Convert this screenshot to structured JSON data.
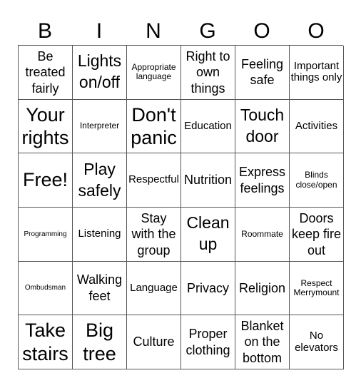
{
  "header": [
    "B",
    "I",
    "N",
    "G",
    "O",
    "O"
  ],
  "cells": [
    {
      "text": "Be treated fairly",
      "size": "l"
    },
    {
      "text": "Lights on/off",
      "size": "xl"
    },
    {
      "text": "Appropriate language",
      "size": "s"
    },
    {
      "text": "Right to own things",
      "size": "l"
    },
    {
      "text": "Feeling safe",
      "size": "l"
    },
    {
      "text": "Important things only",
      "size": "m"
    },
    {
      "text": "Your rights",
      "size": "xxl"
    },
    {
      "text": "Interpreter",
      "size": "s"
    },
    {
      "text": "Don't panic",
      "size": "xxl"
    },
    {
      "text": "Education",
      "size": "m"
    },
    {
      "text": "Touch door",
      "size": "xl"
    },
    {
      "text": "Activities",
      "size": "m"
    },
    {
      "text": "Free!",
      "size": "xxl"
    },
    {
      "text": "Play safely",
      "size": "xl"
    },
    {
      "text": "Respectful",
      "size": "m"
    },
    {
      "text": "Nutrition",
      "size": "l"
    },
    {
      "text": "Express feelings",
      "size": "l"
    },
    {
      "text": "Blinds close/open",
      "size": "s"
    },
    {
      "text": "Programming",
      "size": "xs"
    },
    {
      "text": "Listening",
      "size": "m"
    },
    {
      "text": "Stay with the group",
      "size": "l"
    },
    {
      "text": "Clean up",
      "size": "xl"
    },
    {
      "text": "Roommate",
      "size": "s"
    },
    {
      "text": "Doors keep fire out",
      "size": "l"
    },
    {
      "text": "Ombudsman",
      "size": "xs"
    },
    {
      "text": "Walking feet",
      "size": "l"
    },
    {
      "text": "Language",
      "size": "m"
    },
    {
      "text": "Privacy",
      "size": "l"
    },
    {
      "text": "Religion",
      "size": "l"
    },
    {
      "text": "Respect Merrymount",
      "size": "s"
    },
    {
      "text": "Take stairs",
      "size": "xxl"
    },
    {
      "text": "Big tree",
      "size": "xxl"
    },
    {
      "text": "Culture",
      "size": "l"
    },
    {
      "text": "Proper clothing",
      "size": "l"
    },
    {
      "text": "Blanket on the bottom",
      "size": "l"
    },
    {
      "text": "No elevators",
      "size": "m"
    }
  ]
}
